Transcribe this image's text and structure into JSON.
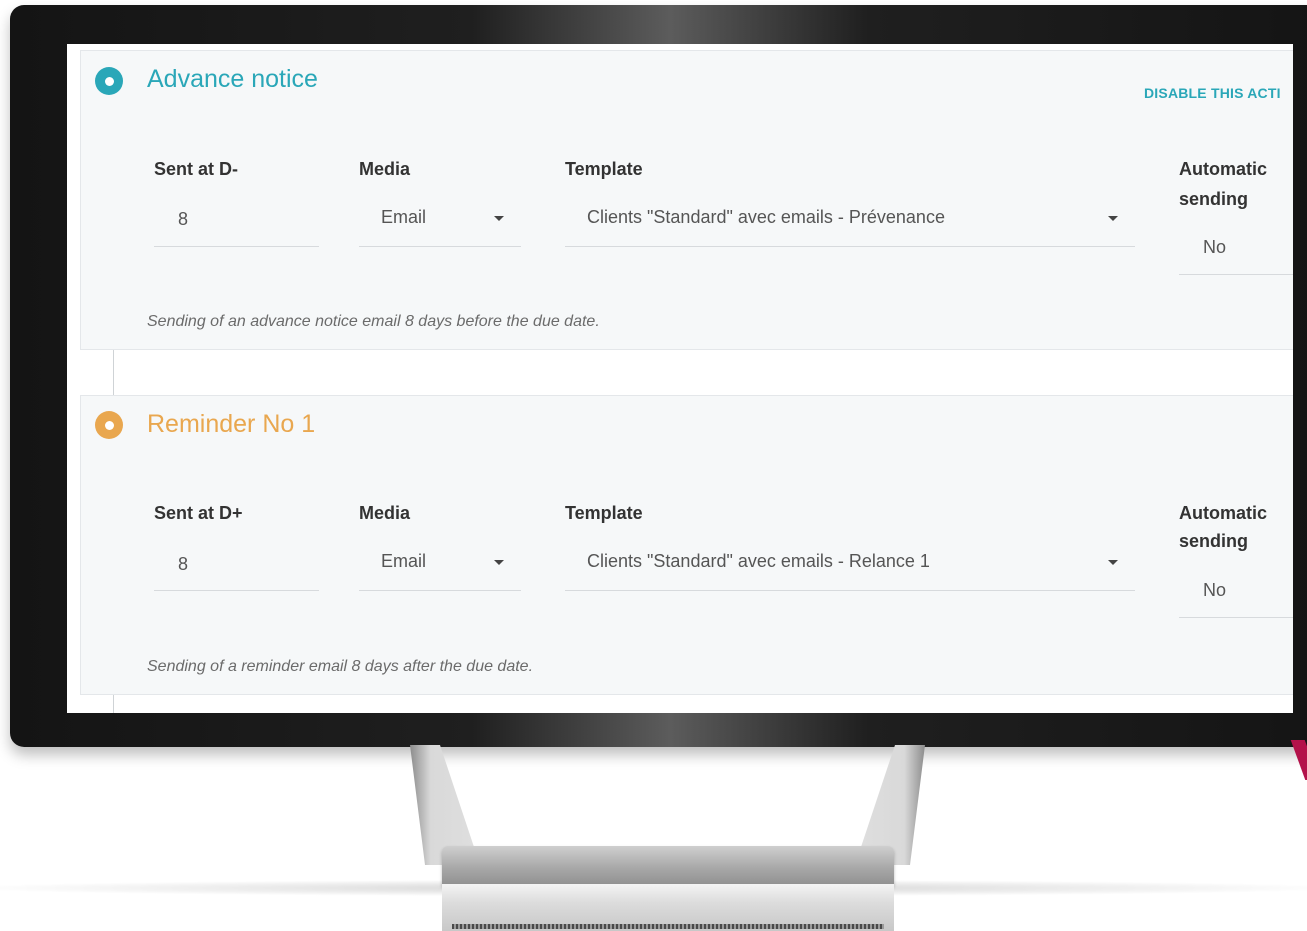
{
  "colors": {
    "step1_accent": "#2aa7b8",
    "step2_accent": "#e9a74f"
  },
  "steps": [
    {
      "title": "Advance notice",
      "action_link": "DISABLE THIS ACTI",
      "sent_label": "Sent at D-",
      "sent_value": "8",
      "media_label": "Media",
      "media_value": "Email",
      "template_label": "Template",
      "template_value": "Clients \"Standard\" avec emails - Prévenance",
      "auto_label_line1": "Automatic",
      "auto_label_line2": "sending",
      "auto_value": "No",
      "description": "Sending of an advance notice email 8 days before the due date."
    },
    {
      "title": "Reminder No 1",
      "sent_label": "Sent at D+",
      "sent_value": "8",
      "media_label": "Media",
      "media_value": "Email",
      "template_label": "Template",
      "template_value": "Clients \"Standard\" avec emails - Relance 1",
      "auto_label_line1": "Automatic",
      "auto_label_line2": "sending",
      "auto_value": "No",
      "description": "Sending of a reminder email 8 days after the due date."
    }
  ]
}
